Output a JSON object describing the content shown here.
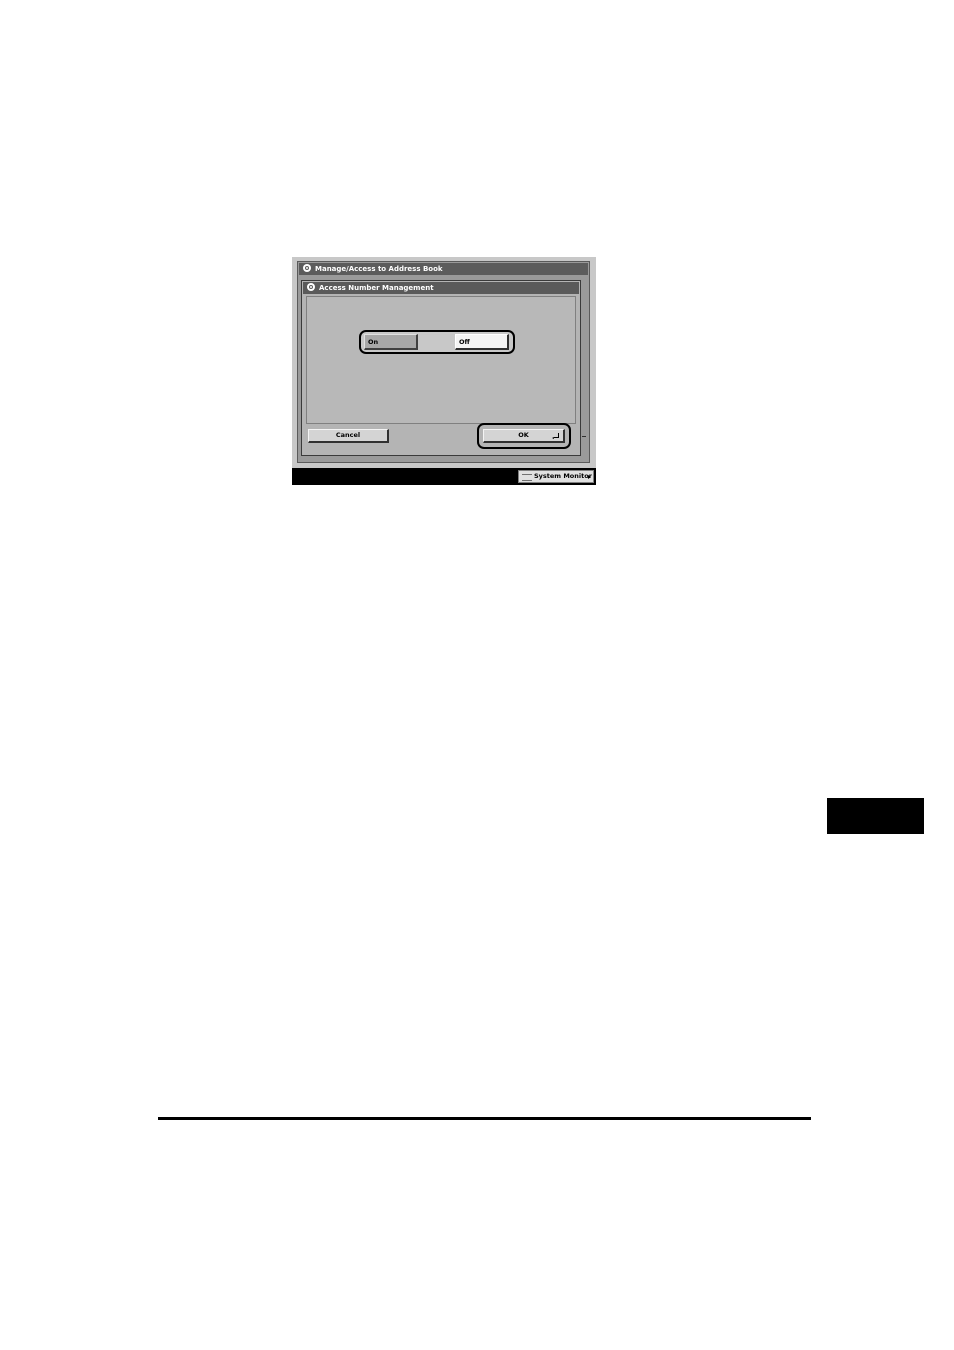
{
  "outer_window": {
    "title": "Manage/Access to Address Book",
    "icon": "settings-icon"
  },
  "dialog": {
    "title": "Access Number Management",
    "icon": "settings-icon",
    "toggle": {
      "on_label": "On",
      "off_label": "Off",
      "selected": "Off"
    },
    "cancel_label": "Cancel",
    "ok_label": "OK"
  },
  "status_bar": {
    "system_monitor_label": "System Monitor"
  }
}
